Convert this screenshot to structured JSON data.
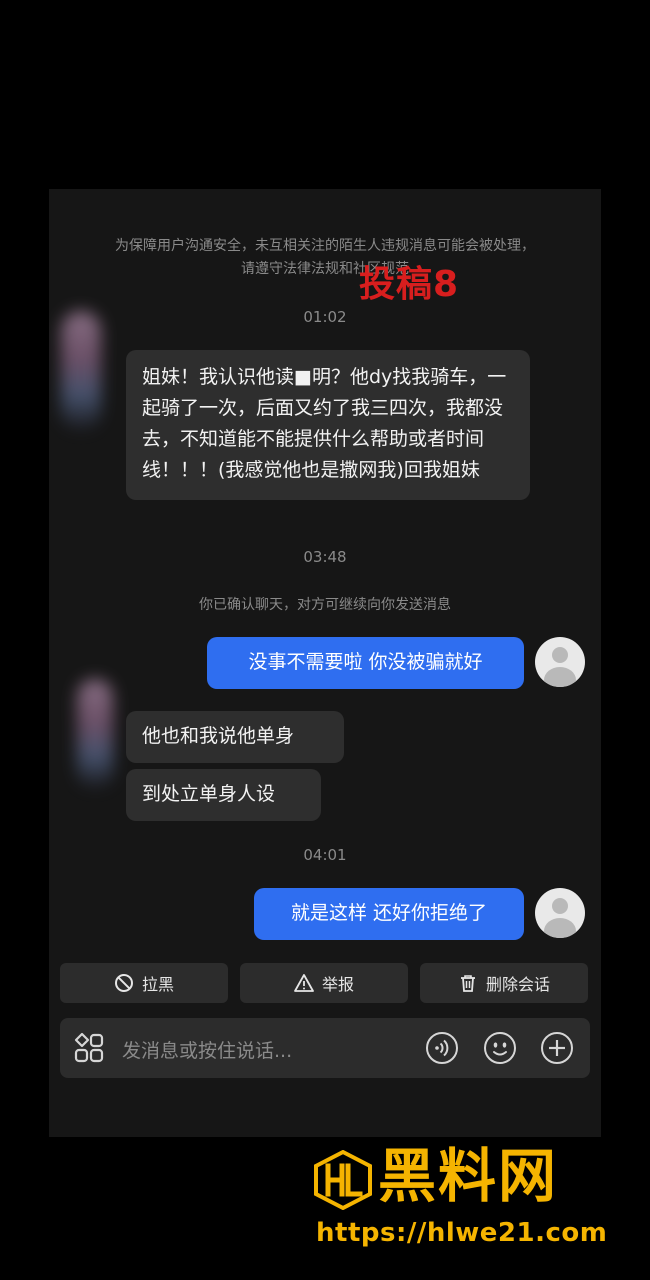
{
  "notice": "为保障用户沟通安全，未互相关注的陌生人违规消息可能会被处理，请遵守法律法规和社区规范",
  "watermark": "投稿8",
  "messages": {
    "time1": "01:02",
    "msg1": "姐妹！我认识他读■明？他dy找我骑车，一起骑了一次，后面又约了我三四次，我都没去，不知道能不能提供什么帮助或者时间线！！！(我感觉他也是撒网我)回我姐妹",
    "time2": "03:48",
    "system": "你已确认聊天，对方可继续向你发送消息",
    "reply1": "没事不需要啦 你没被骗就好",
    "msg2": "他也和我说他单身",
    "msg3": "到处立单身人设",
    "time3": "04:01",
    "reply2": "就是这样 还好你拒绝了"
  },
  "actions": {
    "block": "拉黑",
    "report": "举报",
    "delete": "删除会话"
  },
  "input": {
    "placeholder": "发消息或按住说话..."
  },
  "branding": {
    "name": "黑料网",
    "url": "https://hlwe21.com",
    "color": "#f5b400"
  },
  "colors": {
    "outgoing_bubble": "#2f6ef0",
    "incoming_bubble": "#2e2e2e",
    "watermark": "#d81e1e"
  }
}
